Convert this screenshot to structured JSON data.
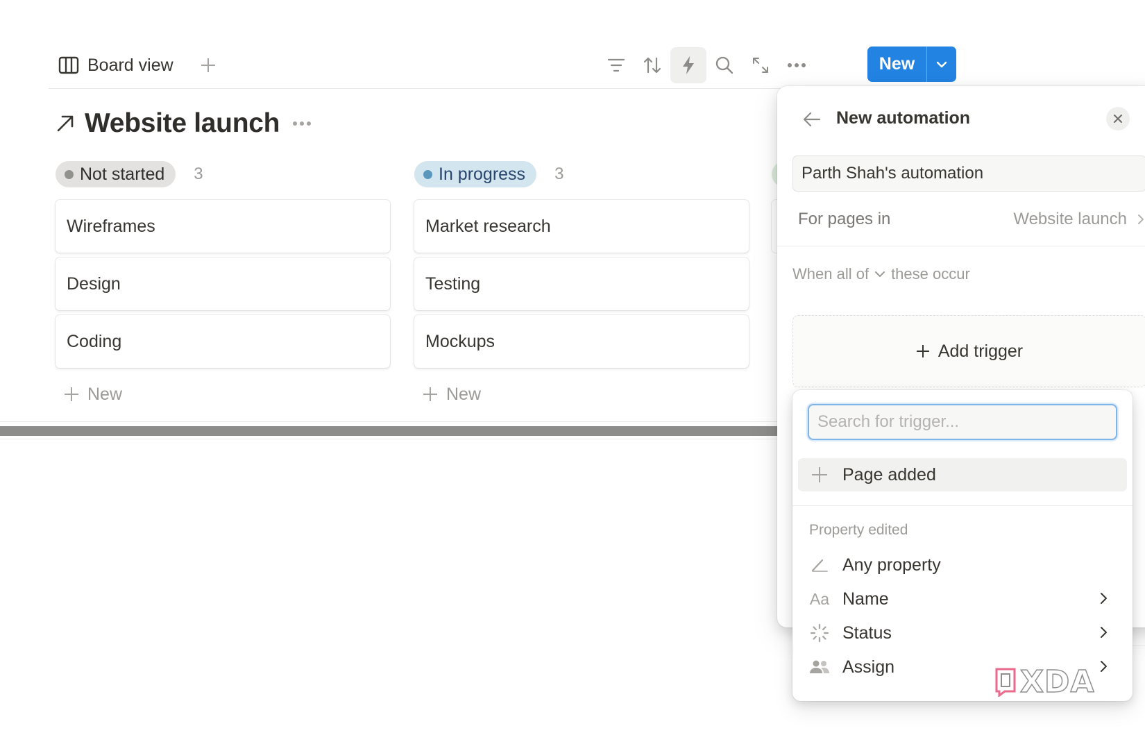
{
  "toolbar": {
    "view_name": "Board view",
    "icons": [
      "board-icon",
      "plus-icon",
      "filter-icon",
      "sort-icon",
      "lightning-icon",
      "search-icon",
      "expand-icon",
      "more-icon"
    ],
    "new_button_label": "New"
  },
  "page": {
    "title": "Website launch"
  },
  "board": {
    "columns": [
      {
        "status": "Not started",
        "count": "3",
        "color": "#91918e",
        "cards": [
          "Wireframes",
          "Design",
          "Coding"
        ],
        "new_label": "New"
      },
      {
        "status": "In progress",
        "count": "3",
        "color": "#5b97bd",
        "cards": [
          "Market research",
          "Testing",
          "Mockups"
        ],
        "new_label": "New"
      }
    ]
  },
  "automation_panel": {
    "title": "New automation",
    "name_value": "Parth Shah's automation",
    "for_pages_label": "For pages in",
    "for_pages_value": "Website launch",
    "when_prefix": "When all of",
    "when_suffix": "these occur",
    "add_trigger_label": "Add trigger"
  },
  "trigger_dropdown": {
    "search_placeholder": "Search for trigger...",
    "page_added_label": "Page added",
    "section_label": "Property edited",
    "items": [
      {
        "label": "Any property",
        "icon": "pencil-icon",
        "has_submenu": false
      },
      {
        "label": "Name",
        "icon": "text-aa-icon",
        "icon_text": "Aa",
        "has_submenu": true
      },
      {
        "label": "Status",
        "icon": "status-spinner-icon",
        "has_submenu": true
      },
      {
        "label": "Assign",
        "icon": "people-icon",
        "has_submenu": true
      }
    ]
  },
  "watermark": {
    "text": "XDA"
  },
  "colors": {
    "accent": "#2383e2",
    "text": "#37352f",
    "muted": "#9b9a97"
  }
}
